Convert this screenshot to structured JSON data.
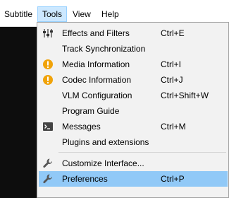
{
  "menubar": {
    "items": [
      {
        "label": "Subtitle"
      },
      {
        "label": "Tools"
      },
      {
        "label": "View"
      },
      {
        "label": "Help"
      }
    ]
  },
  "tools_menu": {
    "items": [
      {
        "label": "Effects and Filters",
        "shortcut": "Ctrl+E",
        "icon": "sliders-icon"
      },
      {
        "label": "Track Synchronization",
        "shortcut": "",
        "icon": ""
      },
      {
        "label": "Media Information",
        "shortcut": "Ctrl+I",
        "icon": "info-icon"
      },
      {
        "label": "Codec Information",
        "shortcut": "Ctrl+J",
        "icon": "info-icon"
      },
      {
        "label": "VLM Configuration",
        "shortcut": "Ctrl+Shift+W",
        "icon": ""
      },
      {
        "label": "Program Guide",
        "shortcut": "",
        "icon": ""
      },
      {
        "label": "Messages",
        "shortcut": "Ctrl+M",
        "icon": "terminal-icon"
      },
      {
        "label": "Plugins and extensions",
        "shortcut": "",
        "icon": ""
      },
      {
        "label": "Customize Interface...",
        "shortcut": "",
        "icon": "wrench-icon"
      },
      {
        "label": "Preferences",
        "shortcut": "Ctrl+P",
        "icon": "wrench-icon"
      }
    ],
    "highlighted": "Preferences"
  },
  "colors": {
    "menu_background": "#f2f2f2",
    "highlight": "#91c9f7",
    "active_menubar": "#cce8ff",
    "info_icon_orange": "#f0a30a",
    "video_background": "#0d0d0d"
  }
}
